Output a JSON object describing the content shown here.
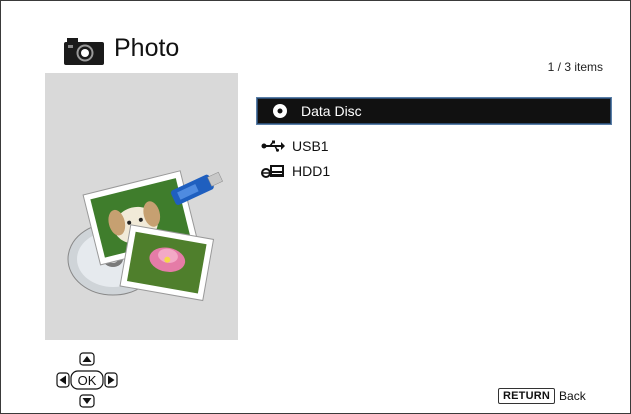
{
  "header": {
    "title": "Photo",
    "item_count": "1 / 3 items",
    "icon": "camera-icon"
  },
  "preview": {
    "icon": "photo-collage-illustration"
  },
  "sources": [
    {
      "label": "Data Disc",
      "icon": "disc-icon",
      "selected": true
    },
    {
      "label": "USB1",
      "icon": "usb-icon",
      "selected": false
    },
    {
      "label": "HDD1",
      "icon": "hdd-icon",
      "selected": false
    }
  ],
  "nav": {
    "ok_label": "OK",
    "icons": [
      "up-arrow-icon",
      "left-arrow-icon",
      "right-arrow-icon",
      "down-arrow-icon"
    ]
  },
  "footer": {
    "return_key": "RETURN",
    "return_label": "Back"
  },
  "colors": {
    "selected_bg": "#111111",
    "selected_border": "#5a7fa8",
    "preview_bg": "#d9d9d9"
  }
}
